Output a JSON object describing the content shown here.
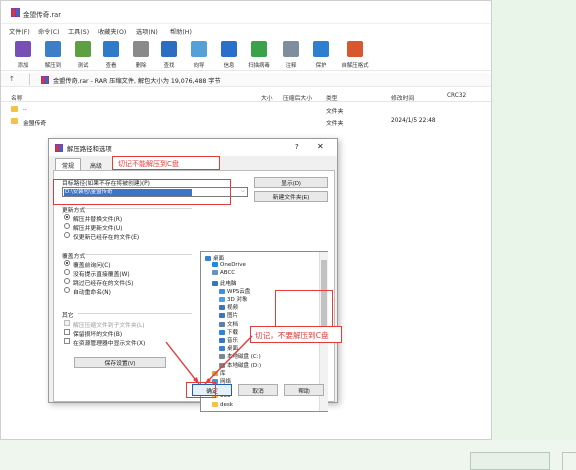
{
  "window": {
    "title": "金盟传奇.rar",
    "menu": [
      "文件(F)",
      "命令(C)",
      "工具(S)",
      "收藏夹(O)",
      "选项(N)",
      "帮助(H)"
    ],
    "toolbar": [
      {
        "label": "添加",
        "icon": "add-icon",
        "color": "#7a4fb5"
      },
      {
        "label": "解压到",
        "icon": "extract-to-icon",
        "color": "#3c7fc8"
      },
      {
        "label": "测试",
        "icon": "test-icon",
        "color": "#5ca042"
      },
      {
        "label": "查看",
        "icon": "view-icon",
        "color": "#2e7bc9"
      },
      {
        "label": "删除",
        "icon": "delete-icon",
        "color": "#8a8a8a"
      },
      {
        "label": "查找",
        "icon": "find-icon",
        "color": "#2c6fc2"
      },
      {
        "label": "向导",
        "icon": "wizard-icon",
        "color": "#56a0d8"
      },
      {
        "label": "信息",
        "icon": "info-icon",
        "color": "#2a6fc9"
      },
      {
        "label": "扫描病毒",
        "icon": "scan-virus-icon",
        "color": "#3aa34a"
      },
      {
        "label": "注释",
        "icon": "comment-icon",
        "color": "#7f8d9d"
      },
      {
        "label": "保护",
        "icon": "protect-icon",
        "color": "#2f7fd0"
      },
      {
        "label": "自解压格式",
        "icon": "sfx-icon",
        "color": "#d9572f"
      }
    ],
    "address": "金盟传奇.rar - RAR 压缩文件, 解包大小为 19,076,488 字节",
    "columns": [
      "名称",
      "大小",
      "压缩后大小",
      "类型",
      "修改时间",
      "CRC32"
    ],
    "rows": [
      {
        "name": "..",
        "type": "文件夹",
        "modified": ""
      },
      {
        "name": "金盟传奇",
        "type": "文件夹",
        "modified": "2024/1/5 22:48"
      }
    ]
  },
  "dialog": {
    "title": "解压路径和选项",
    "help": "?",
    "close": "✕",
    "tabs": [
      "常规",
      "高级"
    ],
    "path_label": "目标路径(如果不存在将被创建)(P)",
    "path_value": "D:\\安装包\\金盟传奇",
    "show_button": "显示(D)",
    "new_folder_button": "新建文件夹(E)",
    "update_mode_label": "更新方式",
    "update_options": [
      "解压并替换文件(R)",
      "解压并更新文件(U)",
      "仅更新已经存在的文件(E)"
    ],
    "overwrite_label": "覆盖方式",
    "overwrite_options": [
      "覆盖前询问(C)",
      "没有提示直接覆盖(W)",
      "跳过已经存在的文件(S)",
      "自动重命名(N)"
    ],
    "misc_label": "其它",
    "misc_options": [
      "解压压缩文件到子文件夹(L)",
      "保留损坏的文件(B)",
      "在资源管理器中显示文件(X)"
    ],
    "save_button": "保存设置(V)",
    "ok": "确定",
    "cancel": "取消",
    "help_button": "帮助",
    "tree": [
      {
        "label": "桌面",
        "indent": 0,
        "icon": "#3c7fd0"
      },
      {
        "label": "OneDrive",
        "indent": 1,
        "icon": "#1e88e5"
      },
      {
        "label": "ABCC",
        "indent": 1,
        "icon": "#6a8fc0"
      },
      {
        "label": "此电脑",
        "indent": 1,
        "icon": "#2f76c9"
      },
      {
        "label": "WPS云盘",
        "indent": 2,
        "icon": "#3b8fe8"
      },
      {
        "label": "3D 对象",
        "indent": 2,
        "icon": "#4aa0e6"
      },
      {
        "label": "视频",
        "indent": 2,
        "icon": "#3b75c2"
      },
      {
        "label": "图片",
        "indent": 2,
        "icon": "#3b75c2"
      },
      {
        "label": "文档",
        "indent": 2,
        "icon": "#5a7fa8"
      },
      {
        "label": "下载",
        "indent": 2,
        "icon": "#2e84d4"
      },
      {
        "label": "音乐",
        "indent": 2,
        "icon": "#3b75c2"
      },
      {
        "label": "桌面",
        "indent": 2,
        "icon": "#3c7fd0"
      },
      {
        "label": "本地磁盘 (C:)",
        "indent": 2,
        "icon": "#7a8794"
      },
      {
        "label": "本地磁盘 (D:)",
        "indent": 2,
        "icon": "#7a8794"
      },
      {
        "label": "库",
        "indent": 1,
        "icon": "#d9a43a"
      },
      {
        "label": "网络",
        "indent": 1,
        "icon": "#4e8fd6"
      },
      {
        "label": "222",
        "indent": 1,
        "icon": "#f2c24b"
      },
      {
        "label": "333",
        "indent": 1,
        "icon": "#f2c24b"
      },
      {
        "label": "desk",
        "indent": 1,
        "icon": "#f2c24b"
      }
    ]
  },
  "annotations": {
    "warn1": "切记不能解压到C盘",
    "warn2": "切记，不要解压到C盘"
  }
}
